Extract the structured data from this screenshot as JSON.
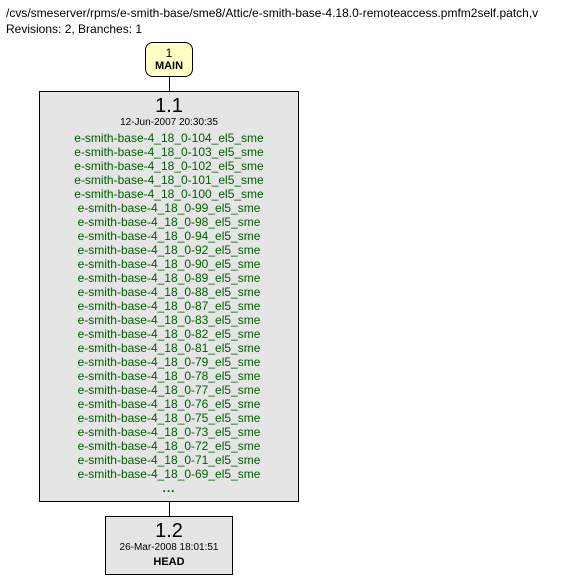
{
  "header": {
    "path": "/cvs/smeserver/rpms/e-smith-base/sme8/Attic/e-smith-base-4.18.0-remoteaccess.pmfm2self.patch,v",
    "meta": "Revisions: 2, Branches: 1"
  },
  "branch": {
    "num": "1",
    "name": "MAIN"
  },
  "rev11": {
    "num": "1.1",
    "date": "12-Jun-2007 20:30:35",
    "tags": [
      "e-smith-base-4_18_0-104_el5_sme",
      "e-smith-base-4_18_0-103_el5_sme",
      "e-smith-base-4_18_0-102_el5_sme",
      "e-smith-base-4_18_0-101_el5_sme",
      "e-smith-base-4_18_0-100_el5_sme",
      "e-smith-base-4_18_0-99_el5_sme",
      "e-smith-base-4_18_0-98_el5_sme",
      "e-smith-base-4_18_0-94_el5_sme",
      "e-smith-base-4_18_0-92_el5_sme",
      "e-smith-base-4_18_0-90_el5_sme",
      "e-smith-base-4_18_0-89_el5_sme",
      "e-smith-base-4_18_0-88_el5_sme",
      "e-smith-base-4_18_0-87_el5_sme",
      "e-smith-base-4_18_0-83_el5_sme",
      "e-smith-base-4_18_0-82_el5_sme",
      "e-smith-base-4_18_0-81_el5_sme",
      "e-smith-base-4_18_0-79_el5_sme",
      "e-smith-base-4_18_0-78_el5_sme",
      "e-smith-base-4_18_0-77_el5_sme",
      "e-smith-base-4_18_0-76_el5_sme",
      "e-smith-base-4_18_0-75_el5_sme",
      "e-smith-base-4_18_0-73_el5_sme",
      "e-smith-base-4_18_0-72_el5_sme",
      "e-smith-base-4_18_0-71_el5_sme",
      "e-smith-base-4_18_0-69_el5_sme"
    ],
    "ellipsis": "..."
  },
  "rev12": {
    "num": "1.2",
    "date": "26-Mar-2008 18:01:51",
    "head": "HEAD"
  }
}
